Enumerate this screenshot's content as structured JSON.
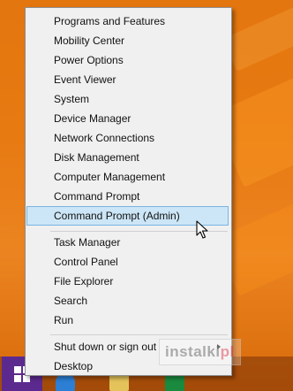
{
  "menu": {
    "groups": [
      {
        "items": [
          {
            "label": "Programs and Features"
          },
          {
            "label": "Mobility Center"
          },
          {
            "label": "Power Options"
          },
          {
            "label": "Event Viewer"
          },
          {
            "label": "System"
          },
          {
            "label": "Device Manager"
          },
          {
            "label": "Network Connections"
          },
          {
            "label": "Disk Management"
          },
          {
            "label": "Computer Management"
          },
          {
            "label": "Command Prompt"
          },
          {
            "label": "Command Prompt (Admin)",
            "highlighted": true
          }
        ]
      },
      {
        "items": [
          {
            "label": "Task Manager"
          },
          {
            "label": "Control Panel"
          },
          {
            "label": "File Explorer"
          },
          {
            "label": "Search"
          },
          {
            "label": "Run"
          }
        ]
      },
      {
        "items": [
          {
            "label": "Shut down or sign out",
            "has_submenu": true
          },
          {
            "label": "Desktop"
          }
        ]
      }
    ]
  },
  "watermark": {
    "text": "instalki",
    "suffix": "pl"
  },
  "colors": {
    "desktop_background": "#e87a12",
    "menu_background": "#f0f0f0",
    "highlight_background": "#cde6f7",
    "highlight_border": "#7ab4e0",
    "start_button": "#5c2a8f"
  },
  "taskbar": {
    "icons": [
      "windows-logo-icon",
      "internet-explorer-icon",
      "file-explorer-icon",
      "store-icon"
    ]
  }
}
